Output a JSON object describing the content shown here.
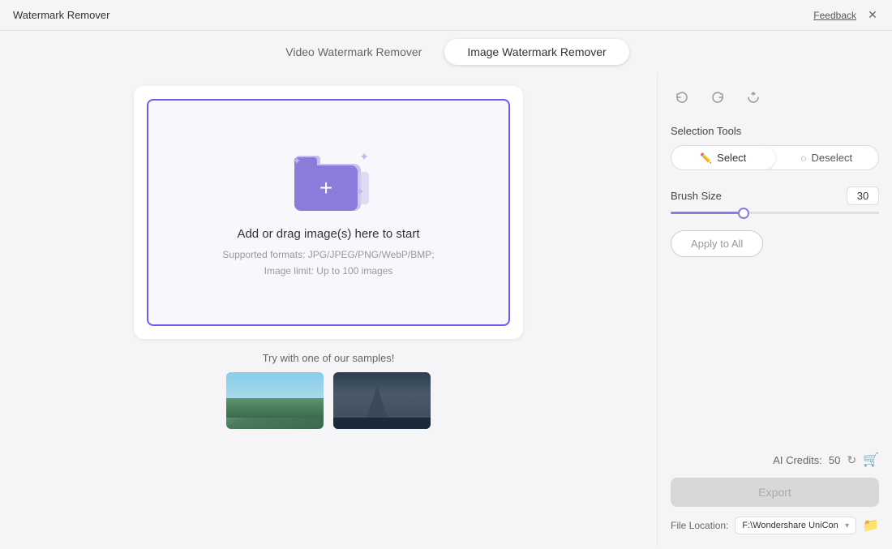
{
  "titleBar": {
    "appName": "Watermark Remover",
    "feedbackLabel": "Feedback",
    "closeIcon": "✕"
  },
  "tabs": [
    {
      "id": "video",
      "label": "Video Watermark Remover",
      "active": false
    },
    {
      "id": "image",
      "label": "Image Watermark Remover",
      "active": true
    }
  ],
  "uploadArea": {
    "title": "Add or drag image(s) here to start",
    "subtitle1": "Supported formats: JPG/JPEG/PNG/WebP/BMP;",
    "subtitle2": "Image limit: Up to 100 images",
    "plusIcon": "+"
  },
  "samples": {
    "sectionLabel": "Try with one of our samples!"
  },
  "rightPanel": {
    "selectionTools": {
      "label": "Selection Tools",
      "selectLabel": "Select",
      "deselectLabel": "Deselect"
    },
    "brushSize": {
      "label": "Brush Size",
      "value": "30",
      "sliderPercent": 35
    },
    "applyAllLabel": "Apply to All",
    "aiCredits": {
      "label": "AI Credits:",
      "value": "50"
    },
    "exportLabel": "Export",
    "fileLocation": {
      "label": "File Location:",
      "path": "F:\\Wondershare UniCon"
    }
  }
}
